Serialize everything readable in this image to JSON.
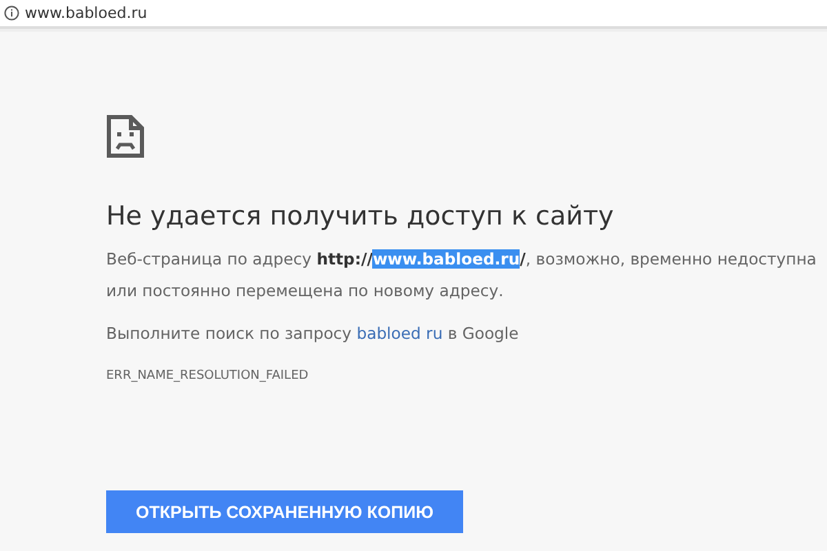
{
  "address_bar": {
    "url": "www.babloed.ru"
  },
  "error": {
    "title": "Не удается получить доступ к сайту",
    "description": [
      {
        "text": "Веб-страница по адресу ",
        "bold": false,
        "selected": false
      },
      {
        "text": "http://",
        "bold": true,
        "selected": false
      },
      {
        "text": "www.babloed.ru",
        "bold": true,
        "selected": true
      },
      {
        "text": "/",
        "bold": true,
        "selected": false
      },
      {
        "text": ", возможно, временно недоступна или постоянно перемещена по новому адресу.",
        "bold": false,
        "selected": false
      }
    ],
    "search": {
      "before": "Выполните поиск по запросу ",
      "link": "babloed ru",
      "after": " в Google"
    },
    "code": "ERR_NAME_RESOLUTION_FAILED"
  },
  "button": {
    "label": "ОТКРЫТЬ СОХРАНЕННУЮ КОПИЮ"
  }
}
